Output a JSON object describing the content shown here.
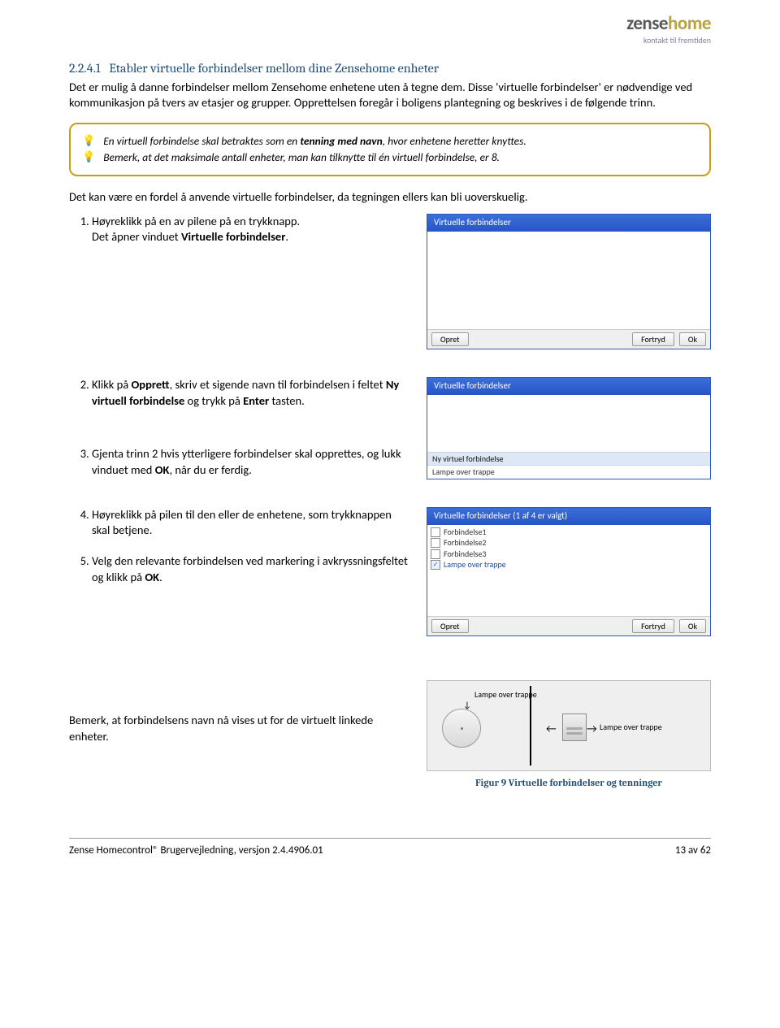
{
  "logo": {
    "brand_left": "zense",
    "brand_right": "home",
    "tagline": "kontakt til fremtiden"
  },
  "heading": {
    "number": "2.2.4.1",
    "title": "Etabler virtuelle forbindelser mellom dine Zensehome enheter"
  },
  "intro1": "Det er mulig å danne forbindelser mellom Zensehome enhetene uten å tegne dem. Disse 'virtuelle forbindelser' er nødvendige ved kommunikasjon på tvers av etasjer og grupper. Opprettelsen foregår i boligens plantegning og beskrives i de følgende trinn.",
  "tips": {
    "t1a": "En virtuell forbindelse skal betraktes som en ",
    "t1b": "tenning med navn",
    "t1c": ", hvor enhetene heretter knyttes.",
    "t2": "Bemerk, at det maksimale antall enheter, man kan tilknytte til én virtuell forbindelse, er 8."
  },
  "para2": "Det kan være en fordel å anvende virtuelle forbindelser, da tegningen ellers kan bli uoverskuelig.",
  "steps": {
    "s1a": "Høyreklikk på en av pilene på en trykknapp.",
    "s1b_pre": "Det åpner vinduet ",
    "s1b_bold": "Virtuelle forbindelser",
    "s1b_post": ".",
    "s2_pre": "Klikk på ",
    "s2_bold1": "Opprett",
    "s2_mid": ", skriv et sigende navn til forbindelsen i feltet ",
    "s2_bold2": "Ny virtuell forbindelse",
    "s2_mid2": " og trykk på ",
    "s2_bold3": "Enter",
    "s2_post": " tasten.",
    "s3_pre": "Gjenta trinn 2 hvis ytterligere forbindelser skal opprettes, og lukk vinduet med ",
    "s3_bold": "OK",
    "s3_post": ", når du er ferdig.",
    "s4": "Høyreklikk på pilen til den eller de enhetene, som trykknappen skal betjene.",
    "s5_pre": "Velg den relevante forbindelsen ved markering i avkryssningsfeltet og klikk på ",
    "s5_bold": "OK",
    "s5_post": "."
  },
  "windows": {
    "title1": "Virtuelle forbindelser",
    "title2": "Virtuelle forbindelser",
    "title3": "Virtuelle forbindelser (1 af 4 er valgt)",
    "btn_opret": "Opret",
    "btn_fortryd": "Fortryd",
    "btn_ok": "Ok",
    "row_new": "Ny virtuel forbindelse",
    "row_lampe": "Lampe over trappe",
    "chk1": "Forbindelse1",
    "chk2": "Forbindelse2",
    "chk3": "Forbindelse3",
    "chk4": "Lampe over trappe"
  },
  "diagram": {
    "label_top": "Lampe over trappe",
    "label_right": "Lampe over trappe"
  },
  "final_para": "Bemerk, at forbindelsens navn nå vises ut for de virtuelt linkede enheter.",
  "figcaption": "Figur 9 Virtuelle forbindelser og tenninger",
  "footer": {
    "left": "Zense Homecontrol® Brugervejledning, versjon 2.4.4906.01",
    "right": "13 av 62"
  }
}
